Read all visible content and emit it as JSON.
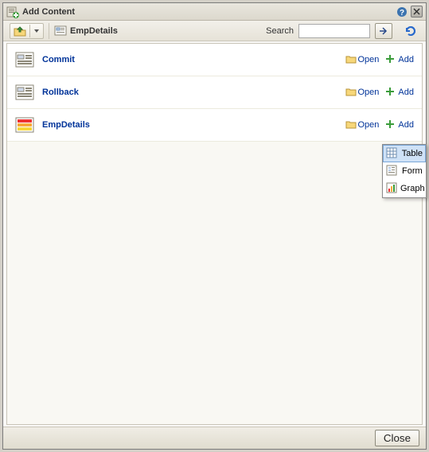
{
  "title": "Add Content",
  "breadcrumb": "EmpDetails",
  "search": {
    "label": "Search",
    "value": "",
    "placeholder": ""
  },
  "rows": [
    {
      "title": "Commit",
      "open": "Open",
      "add": "Add",
      "icon": "operation"
    },
    {
      "title": "Rollback",
      "open": "Open",
      "add": "Add",
      "icon": "operation"
    },
    {
      "title": "EmpDetails",
      "open": "Open",
      "add": "Add",
      "icon": "data"
    }
  ],
  "popup": {
    "items": [
      {
        "label": "Table",
        "selected": true
      },
      {
        "label": "Form",
        "selected": false
      },
      {
        "label": "Graph",
        "selected": false
      }
    ]
  },
  "footer": {
    "close": "Close"
  }
}
